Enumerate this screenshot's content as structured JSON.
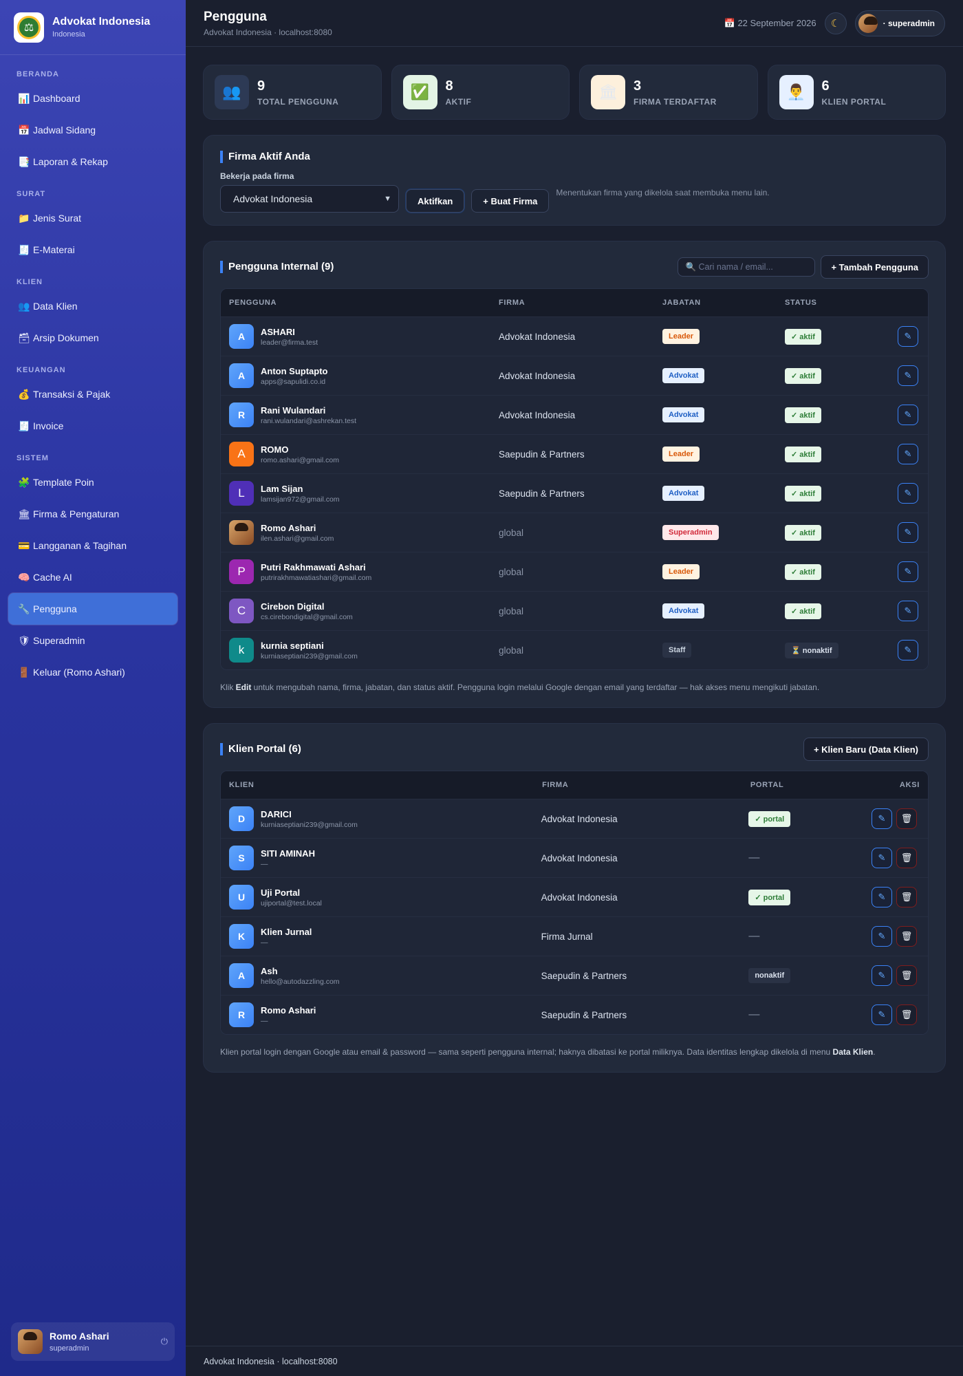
{
  "app": {
    "name": "Advokat Indonesia",
    "subtitle": "Indonesia"
  },
  "sidebar": {
    "sections": [
      {
        "label": "BERANDA",
        "items": [
          {
            "icon": "📊",
            "label": "Dashboard"
          },
          {
            "icon": "📅",
            "label": "Jadwal Sidang"
          },
          {
            "icon": "📑",
            "label": "Laporan & Rekap"
          }
        ]
      },
      {
        "label": "SURAT",
        "items": [
          {
            "icon": "📁",
            "label": "Jenis Surat"
          },
          {
            "icon": "🧾",
            "label": "E-Materai"
          }
        ]
      },
      {
        "label": "KLIEN",
        "items": [
          {
            "icon": "👥",
            "label": "Data Klien"
          },
          {
            "icon": "🗃",
            "label": "Arsip Dokumen"
          }
        ]
      },
      {
        "label": "KEUANGAN",
        "items": [
          {
            "icon": "💰",
            "label": "Transaksi & Pajak"
          },
          {
            "icon": "🧾",
            "label": "Invoice"
          }
        ]
      },
      {
        "label": "SISTEM",
        "items": [
          {
            "icon": "🧩",
            "label": "Template Poin"
          },
          {
            "icon": "🏛",
            "label": "Firma & Pengaturan"
          },
          {
            "icon": "💳",
            "label": "Langganan & Tagihan"
          },
          {
            "icon": "🧠",
            "label": "Cache AI"
          },
          {
            "icon": "🔧",
            "label": "Pengguna",
            "active": true
          },
          {
            "icon": "🛡",
            "label": "Superadmin"
          },
          {
            "icon": "🚪",
            "label": "Keluar (Romo Ashari)"
          }
        ]
      }
    ],
    "user": {
      "name": "Romo Ashari",
      "role": "superadmin"
    }
  },
  "header": {
    "title": "Pengguna",
    "subtitle": "Advokat Indonesia · localhost:8080",
    "date": "📅 22 September 2026",
    "user_label": "· superadmin"
  },
  "stats": [
    {
      "icon": "👥",
      "value": "9",
      "label": "TOTAL PENGGUNA",
      "bg": "#2d3a55"
    },
    {
      "icon": "✅",
      "value": "8",
      "label": "AKTIF",
      "bg": "#e3f4e5"
    },
    {
      "icon": "🏛",
      "value": "3",
      "label": "FIRMA TERDAFTAR",
      "bg": "#fdf0dc"
    },
    {
      "icon": "👨‍💼",
      "value": "6",
      "label": "KLIEN PORTAL",
      "bg": "#e6f0ff"
    }
  ],
  "firma": {
    "title": "Firma Aktif Anda",
    "label": "Bekerja pada firma",
    "selected": "Advokat Indonesia",
    "activate_label": "Aktifkan",
    "create_label": "+ Buat Firma",
    "hint": "Menentukan firma yang dikelola saat membuka menu lain."
  },
  "internal": {
    "title": "Pengguna Internal (9)",
    "search_placeholder": "🔍 Cari nama / email...",
    "add_label": "+ Tambah Pengguna",
    "columns": [
      "PENGGUNA",
      "FIRMA",
      "JABATAN",
      "STATUS"
    ],
    "rows": [
      {
        "initial": "A",
        "avatar": "blue",
        "name": "ASHARI",
        "email": "leader@firma.test",
        "firma": "Advokat Indonesia",
        "role": "Leader",
        "role_class": "b-leader",
        "status": "✓ aktif",
        "status_class": "b-aktif"
      },
      {
        "initial": "A",
        "avatar": "blue",
        "name": "Anton Suptapto",
        "email": "apps@sapulidi.co.id",
        "firma": "Advokat Indonesia",
        "role": "Advokat",
        "role_class": "b-advokat",
        "status": "✓ aktif",
        "status_class": "b-aktif"
      },
      {
        "initial": "R",
        "avatar": "blue",
        "name": "Rani Wulandari",
        "email": "rani.wulandari@ashrekan.test",
        "firma": "Advokat Indonesia",
        "role": "Advokat",
        "role_class": "b-advokat",
        "status": "✓ aktif",
        "status_class": "b-aktif"
      },
      {
        "initial": "A",
        "avatar": "orange",
        "name": "ROMO",
        "email": "romo.ashari@gmail.com",
        "firma": "Saepudin & Partners",
        "role": "Leader",
        "role_class": "b-leader",
        "status": "✓ aktif",
        "status_class": "b-aktif"
      },
      {
        "initial": "L",
        "avatar": "indigo",
        "name": "Lam Sijan",
        "email": "lamsijan972@gmail.com",
        "firma": "Saepudin & Partners",
        "role": "Advokat",
        "role_class": "b-advokat",
        "status": "✓ aktif",
        "status_class": "b-aktif"
      },
      {
        "initial": "",
        "avatar": "photo",
        "name": "Romo Ashari",
        "email": "ilen.ashari@gmail.com",
        "firma": "global",
        "muted": true,
        "role": "Superadmin",
        "role_class": "b-super",
        "status": "✓ aktif",
        "status_class": "b-aktif"
      },
      {
        "initial": "P",
        "avatar": "purple",
        "name": "Putri Rakhmawati Ashari",
        "email": "putrirakhmawatiashari@gmail.com",
        "firma": "global",
        "muted": true,
        "role": "Leader",
        "role_class": "b-leader",
        "status": "✓ aktif",
        "status_class": "b-aktif"
      },
      {
        "initial": "C",
        "avatar": "violet",
        "name": "Cirebon Digital",
        "email": "cs.cirebondigital@gmail.com",
        "firma": "global",
        "muted": true,
        "role": "Advokat",
        "role_class": "b-advokat",
        "status": "✓ aktif",
        "status_class": "b-aktif"
      },
      {
        "initial": "k",
        "avatar": "teal",
        "name": "kurnia septiani",
        "email": "kurniaseptiani239@gmail.com",
        "firma": "global",
        "muted": true,
        "role": "Staff",
        "role_class": "b-staff",
        "status": "⏳ nonaktif",
        "status_class": "b-non"
      }
    ],
    "note_pre": "Klik ",
    "note_bold": "Edit",
    "note_post": " untuk mengubah nama, firma, jabatan, dan status aktif. Pengguna login melalui Google dengan email yang terdaftar — hak akses menu mengikuti jabatan."
  },
  "portal": {
    "title": "Klien Portal (6)",
    "add_label": "+ Klien Baru (Data Klien)",
    "columns": [
      "KLIEN",
      "FIRMA",
      "PORTAL",
      "AKSI"
    ],
    "rows": [
      {
        "initial": "D",
        "name": "DARICI",
        "email": "kurniaseptiani239@gmail.com",
        "firma": "Advokat Indonesia",
        "portal": "✓ portal",
        "portal_class": "b-aktif"
      },
      {
        "initial": "S",
        "name": "SITI AMINAH",
        "email": "—",
        "firma": "Advokat Indonesia",
        "portal": "—",
        "portal_class": "dash"
      },
      {
        "initial": "U",
        "name": "Uji Portal",
        "email": "ujiportal@test.local",
        "firma": "Advokat Indonesia",
        "portal": "✓ portal",
        "portal_class": "b-aktif"
      },
      {
        "initial": "K",
        "name": "Klien Jurnal",
        "email": "—",
        "firma": "Firma Jurnal",
        "portal": "—",
        "portal_class": "dash"
      },
      {
        "initial": "A",
        "name": "Ash",
        "email": "hello@autodazzling.com",
        "firma": "Saepudin & Partners",
        "portal": "nonaktif",
        "portal_class": "b-non"
      },
      {
        "initial": "R",
        "name": "Romo Ashari",
        "email": "—",
        "firma": "Saepudin & Partners",
        "portal": "—",
        "portal_class": "dash"
      }
    ],
    "note_pre": "Klien portal login dengan Google atau email & password — sama seperti pengguna internal; haknya dibatasi ke portal miliknya. Data identitas lengkap dikelola di menu ",
    "note_bold": "Data Klien",
    "note_post": "."
  },
  "footer": "Advokat Indonesia · localhost:8080"
}
